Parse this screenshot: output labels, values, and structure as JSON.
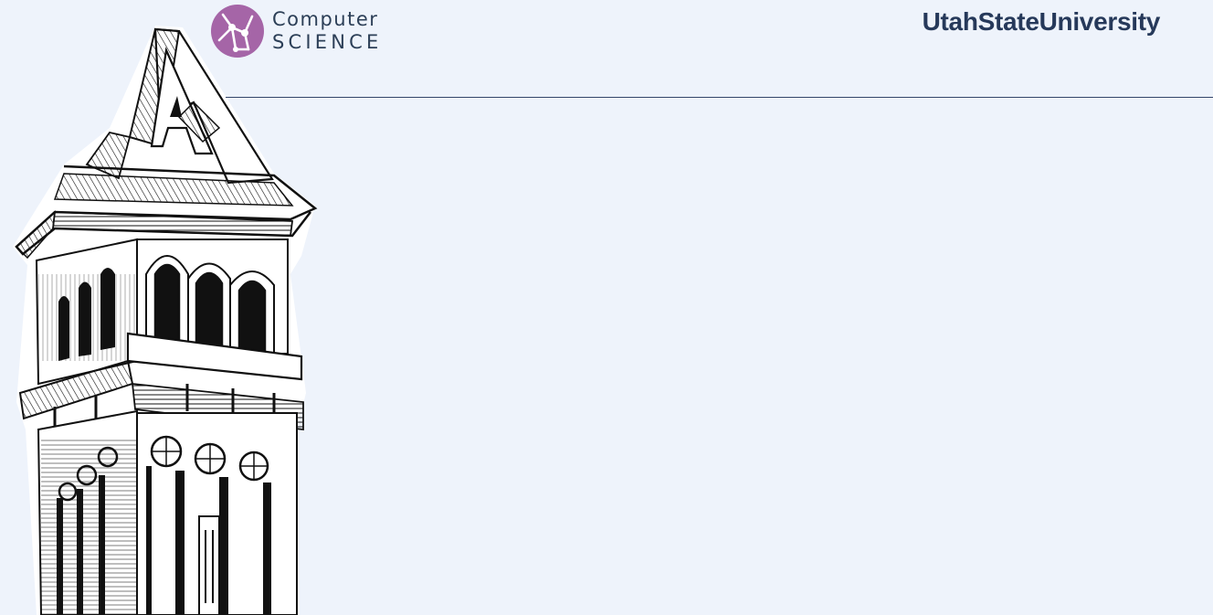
{
  "header": {
    "department_line1": "Computer",
    "department_line2": "SCIENCE",
    "university": "UtahStateUniversity"
  },
  "colors": {
    "background": "#eef3fb",
    "logo_purple": "#a565a7",
    "title_navy": "#26395a",
    "rule": "#34466a"
  },
  "icons": {
    "department_logo": "network-nodes-icon",
    "tower": "clock-tower-illustration"
  }
}
